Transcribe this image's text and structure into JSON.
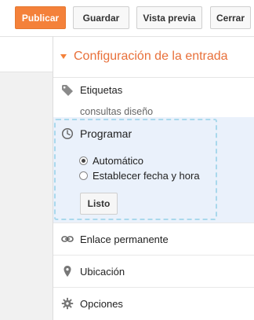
{
  "toolbar": {
    "publish_label": "Publicar",
    "save_label": "Guardar",
    "preview_label": "Vista previa",
    "close_label": "Cerrar"
  },
  "panel": {
    "title": "Configuración de la entrada",
    "tags": {
      "label": "Etiquetas",
      "value": "consultas diseño"
    },
    "schedule": {
      "title": "Programar",
      "options": [
        {
          "label": "Automático",
          "selected": true
        },
        {
          "label": "Establecer fecha y hora",
          "selected": false
        }
      ],
      "done_label": "Listo"
    },
    "permalink_label": "Enlace permanente",
    "location_label": "Ubicación",
    "options_label": "Opciones"
  },
  "colors": {
    "accent": "#f4813a",
    "title": "#e8703a",
    "highlight": "#eaf1fb",
    "dashed_border": "#a9d8ec"
  }
}
